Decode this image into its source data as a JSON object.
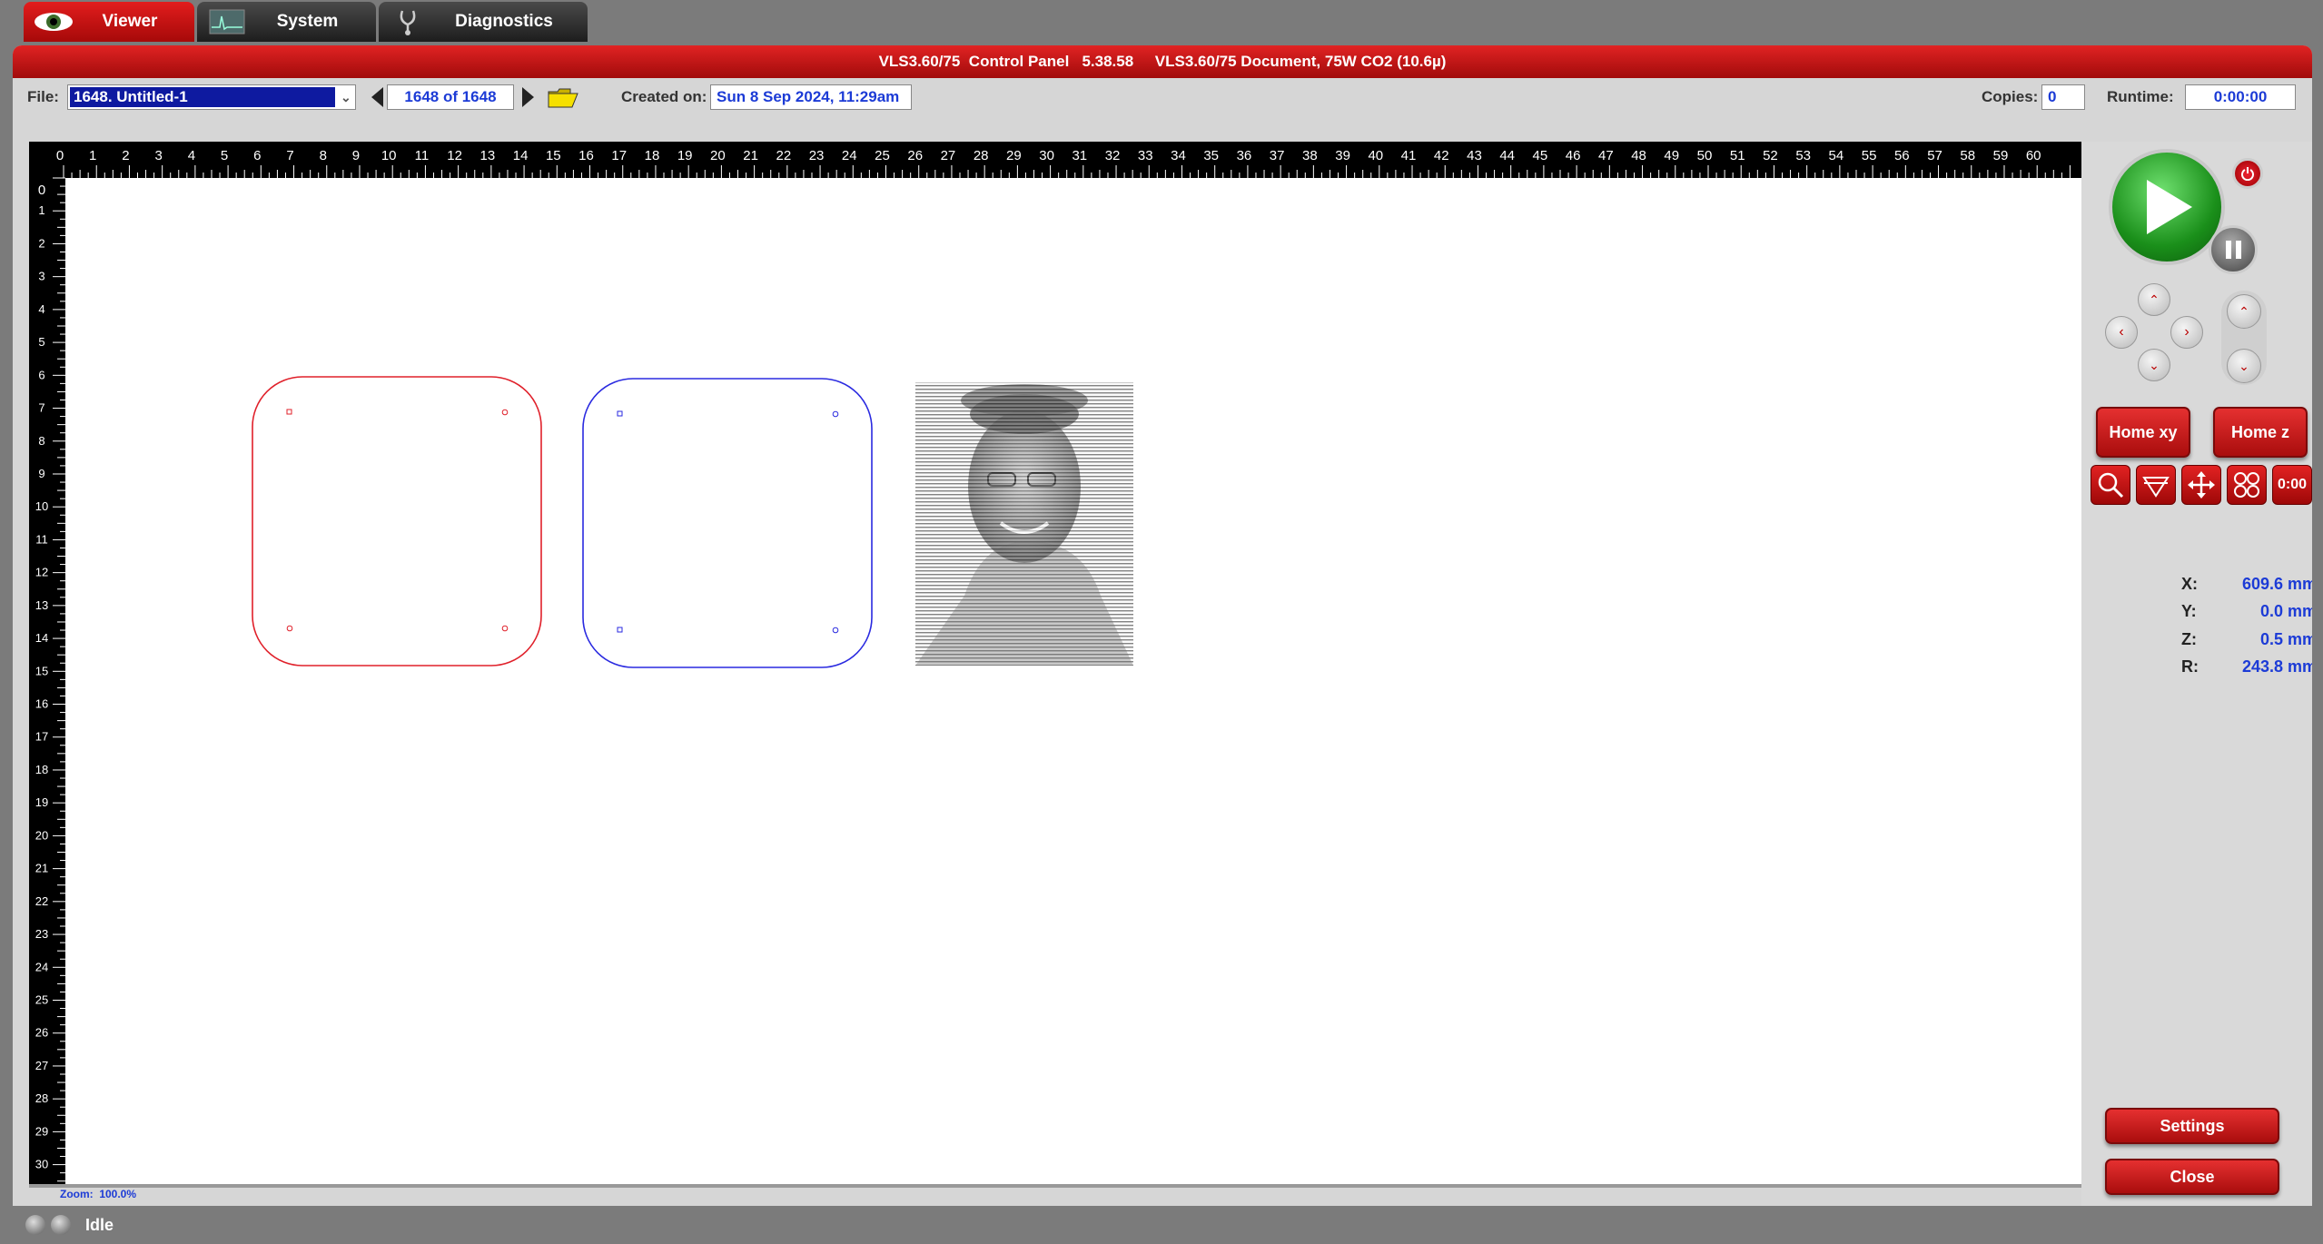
{
  "tabs": [
    {
      "label": "Viewer",
      "icon": "eye-icon"
    },
    {
      "label": "System",
      "icon": "monitor-icon"
    },
    {
      "label": "Diagnostics",
      "icon": "stethoscope-icon"
    }
  ],
  "window": {
    "title": "VLS3.60/75  Control Panel   5.38.58     VLS3.60/75 Document, 75W CO2 (10.6µ)"
  },
  "toolbar": {
    "file_label": "File:",
    "file_value": "1648. Untitled-1",
    "counter": "1648 of 1648",
    "created_label": "Created on:",
    "created_value": "Sun 8 Sep 2024, 11:29am",
    "copies_label": "Copies:",
    "copies_value": "0",
    "runtime_label": "Runtime:",
    "runtime_value": "0:00:00"
  },
  "ruler": {
    "top": [
      "0",
      "1",
      "2",
      "3",
      "4",
      "5",
      "6",
      "7",
      "8",
      "9",
      "10",
      "11",
      "12",
      "13",
      "14",
      "15",
      "16",
      "17",
      "18",
      "19",
      "20",
      "21",
      "22",
      "23",
      "24",
      "25",
      "26",
      "27",
      "28",
      "29",
      "30",
      "31",
      "32",
      "33",
      "34",
      "35",
      "36",
      "37",
      "38",
      "39",
      "40",
      "41",
      "42",
      "43",
      "44",
      "45",
      "46",
      "47",
      "48",
      "49",
      "50",
      "51",
      "52",
      "53",
      "54",
      "55",
      "56",
      "57",
      "58",
      "59",
      "60"
    ],
    "left": [
      "1",
      "2",
      "3",
      "4",
      "5",
      "6",
      "7",
      "8",
      "9",
      "10",
      "11",
      "12",
      "13",
      "14",
      "15",
      "16",
      "17",
      "18",
      "19",
      "20",
      "21",
      "22",
      "23",
      "24",
      "25",
      "26",
      "27",
      "28",
      "29",
      "30"
    ]
  },
  "zoom": "Zoom:  100.0%",
  "controls": {
    "home_xy": "Home xy",
    "home_z": "Home z",
    "settings": "Settings",
    "close": "Close",
    "timer_icon_text": "0:00"
  },
  "coords": [
    {
      "k": "X:",
      "v": "609.6 mm"
    },
    {
      "k": "Y:",
      "v": "0.0 mm"
    },
    {
      "k": "Z:",
      "v": "0.5 mm"
    },
    {
      "k": "R:",
      "v": "243.8 mm"
    }
  ],
  "status": "Idle",
  "colors": {
    "accent": "#c41212",
    "value_blue": "#1c3bd6",
    "cut_red": "#e0202a",
    "cut_blue": "#2a2ae0"
  }
}
